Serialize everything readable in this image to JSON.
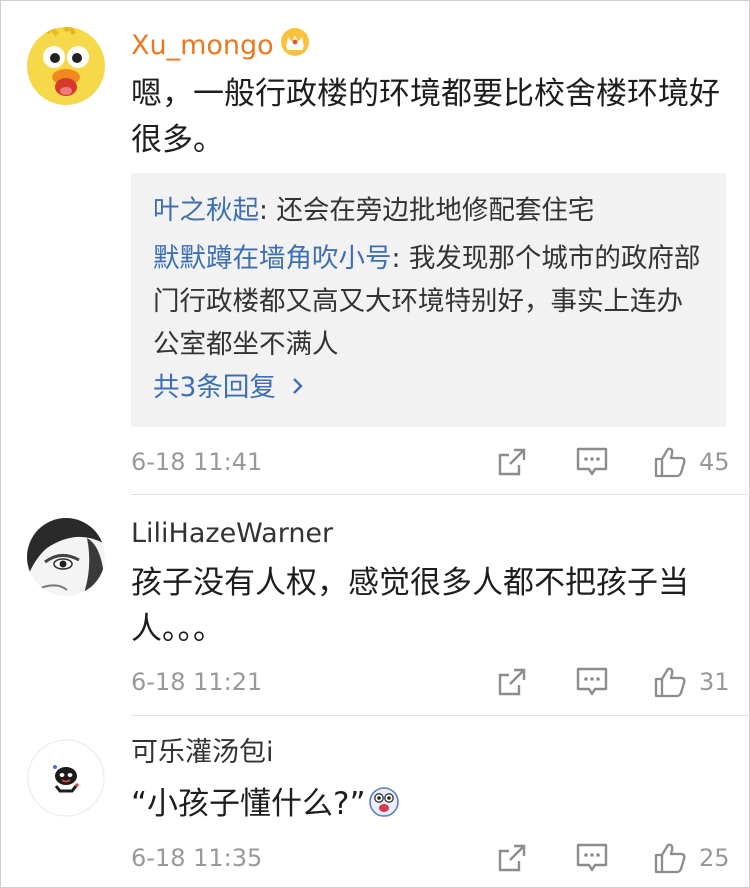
{
  "comments": [
    {
      "username": "Xu_mongo",
      "vip_badge_icon": "crown-badge-icon",
      "text": "嗯，一般行政楼的环境都要比校舍楼环境好很多。",
      "replies": [
        {
          "name": "叶之秋起",
          "text": ": 还会在旁边批地修配套住宅"
        },
        {
          "name": "默默蹲在墙角吹小号",
          "text": ": 我发现那个城市的政府部门行政楼都又高又大环境特别好，事实上连办公室都坐不满人"
        }
      ],
      "more_replies": "共3条回复",
      "time": "6-18 11:41",
      "likes": "45"
    },
    {
      "username": "LiliHazeWarner",
      "text": "孩子没有人权，感觉很多人都不把孩子当人。。。",
      "time": "6-18 11:21",
      "likes": "31"
    },
    {
      "username": "可乐灌汤包i",
      "text": "“小孩子懂什么?”",
      "emoji_icon": "shocked-face-emoji-icon",
      "time": "6-18 11:35",
      "likes": "25"
    }
  ],
  "icons": {
    "share": "share-icon",
    "comment": "comment-icon",
    "like": "thumbs-up-icon",
    "chevron": "chevron-right-icon"
  },
  "colors": {
    "vip_name": "#e8791e",
    "link": "#3e6fb2",
    "meta_text": "#999999",
    "reply_background": "#f2f2f2"
  }
}
